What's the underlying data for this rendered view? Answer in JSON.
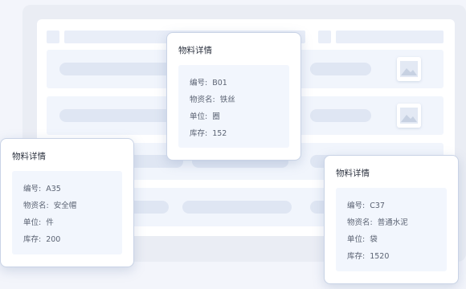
{
  "popups": [
    {
      "title": "物料详情",
      "fields": [
        {
          "label": "编号",
          "value": "B01"
        },
        {
          "label": "物资名",
          "value": "铁丝"
        },
        {
          "label": "单位",
          "value": "圈"
        },
        {
          "label": "库存",
          "value": "152"
        }
      ]
    },
    {
      "title": "物料详情",
      "fields": [
        {
          "label": "编号",
          "value": "A35"
        },
        {
          "label": "物资名",
          "value": "安全帽"
        },
        {
          "label": "单位",
          "value": "件"
        },
        {
          "label": "库存",
          "value": "200"
        }
      ]
    },
    {
      "title": "物料详情",
      "fields": [
        {
          "label": "编号",
          "value": "C37"
        },
        {
          "label": "物资名",
          "value": "普通水泥"
        },
        {
          "label": "单位",
          "value": "袋"
        },
        {
          "label": "库存",
          "value": "1520"
        }
      ]
    }
  ],
  "icons": {
    "thumbnail": "image-placeholder-icon"
  },
  "colors": {
    "page_bg": "#f3f5fb",
    "row_bg": "#f1f5fc",
    "skeleton": "#dfe6f3",
    "popup_body": "#f2f6fd",
    "title_text": "#2d3340",
    "field_text": "#5b6373"
  }
}
